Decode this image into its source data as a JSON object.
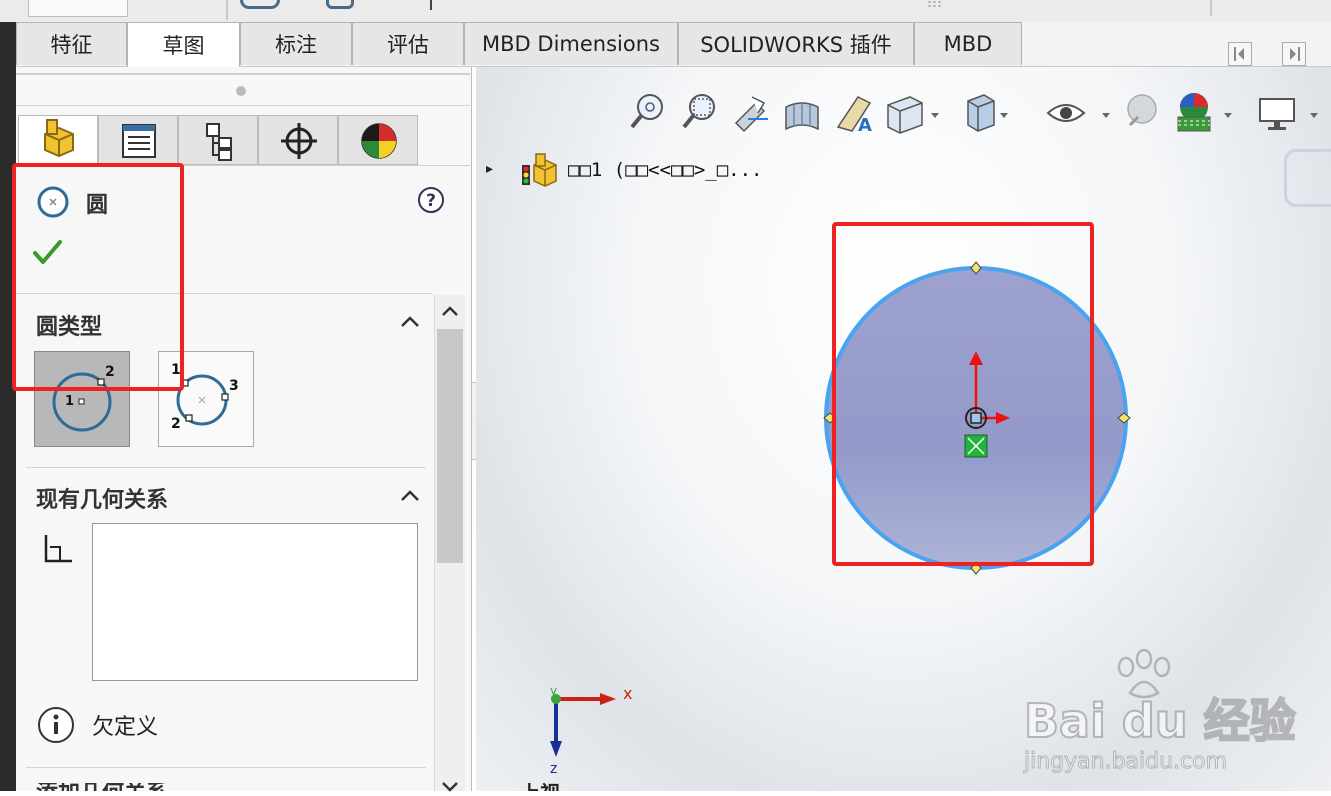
{
  "tabs": [
    "特征",
    "草图",
    "标注",
    "评估",
    "MBD Dimensions",
    "SOLIDWORKS 插件",
    "MBD"
  ],
  "active_tab_index": 1,
  "property_manager": {
    "title": "圆",
    "sections": {
      "circle_type": {
        "title": "圆类型"
      },
      "existing_relations": {
        "title": "现有几何关系"
      },
      "status": "欠定义",
      "add_relations": {
        "title": "添加几何关系"
      }
    },
    "circle_type_labels": {
      "center": {
        "center": "1",
        "radius": "2"
      },
      "perimeter": {
        "p1": "1",
        "p2": "2",
        "p3": "3"
      }
    }
  },
  "feature_tree": {
    "root_label": "□□1  (□□<<□□>_□..."
  },
  "triad": {
    "x": "x",
    "y": "y",
    "z": "z"
  },
  "view_label": "上视",
  "watermark": {
    "brand": "Bai du 经验",
    "url": "jingyan.baidu.com"
  },
  "colors": {
    "highlight": "#ee2222",
    "circle_fill": "#9aa0cc",
    "circle_stroke": "#4aa3f0"
  }
}
